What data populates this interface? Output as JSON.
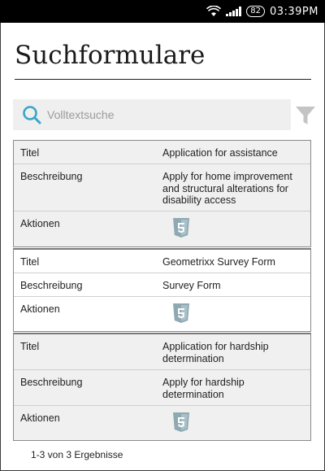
{
  "status_bar": {
    "battery": "82",
    "time": "03:39PM"
  },
  "page": {
    "title": "Suchformulare"
  },
  "search": {
    "placeholder": "Volltextsuche"
  },
  "labels": {
    "title": "Titel",
    "description": "Beschreibung",
    "actions": "Aktionen"
  },
  "results": [
    {
      "title": "Application for assistance",
      "description": "Apply for home improvement and structural alterations for disability access"
    },
    {
      "title": "Geometrixx Survey Form",
      "description": "Survey Form"
    },
    {
      "title": "Application for hardship determination",
      "description": "Apply for hardship determination"
    }
  ],
  "footer": {
    "summary": "1-3 von 3 Ergebnisse"
  },
  "colors": {
    "accent": "#3aa6c8",
    "card_grey": "#f0f0f0",
    "icon_grey": "#8fa9b3"
  },
  "icons": {
    "search": "search-icon",
    "filter": "filter-icon",
    "action": "html5-icon"
  }
}
